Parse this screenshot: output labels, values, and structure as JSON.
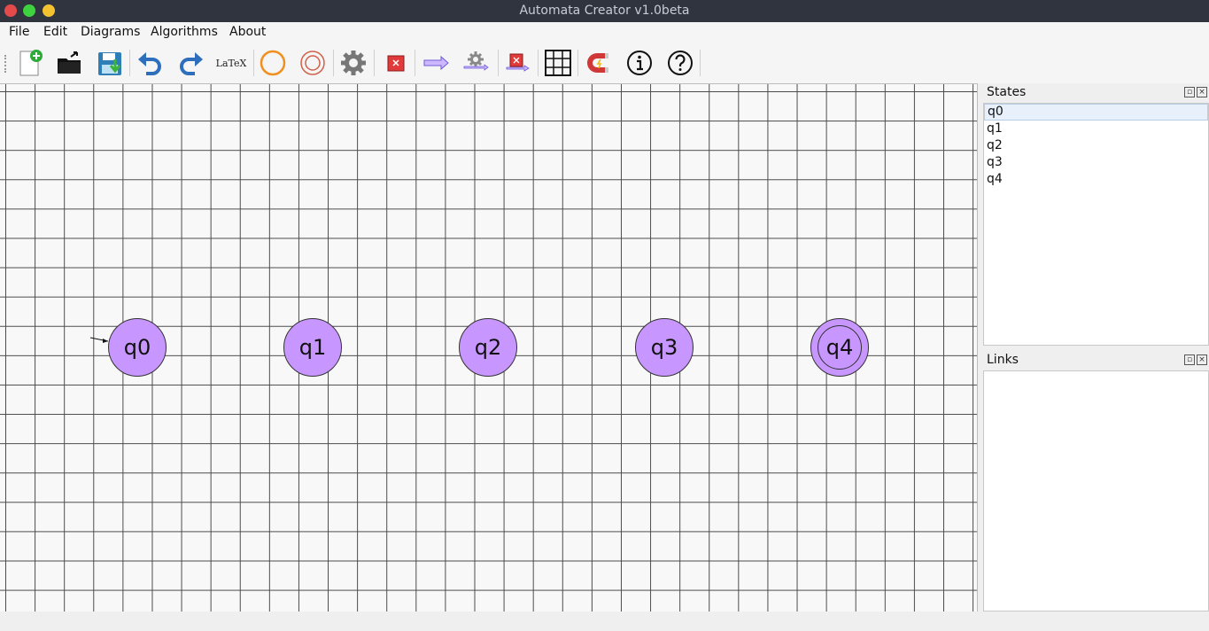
{
  "window": {
    "title": "Automata Creator v1.0beta"
  },
  "menu": {
    "items": [
      "File",
      "Edit",
      "Diagrams",
      "Algorithms",
      "About"
    ]
  },
  "toolbar": {
    "latex_label": "LaTeX",
    "buttons": [
      "new-document-icon",
      "open-folder-icon",
      "save-icon",
      "undo-icon",
      "redo-icon",
      "latex-icon",
      "add-state-icon",
      "add-final-state-icon",
      "state-settings-icon",
      "delete-state-icon",
      "add-link-icon",
      "link-settings-icon",
      "delete-link-icon",
      "grid-icon",
      "magnet-icon",
      "info-icon",
      "help-icon"
    ]
  },
  "diagram": {
    "initial_state": "q0",
    "states": [
      {
        "name": "q0",
        "final": false
      },
      {
        "name": "q1",
        "final": false
      },
      {
        "name": "q2",
        "final": false
      },
      {
        "name": "q3",
        "final": false
      },
      {
        "name": "q4",
        "final": true
      }
    ]
  },
  "states_panel": {
    "title": "States",
    "items": [
      "q0",
      "q1",
      "q2",
      "q3",
      "q4"
    ],
    "selected": "q0"
  },
  "links_panel": {
    "title": "Links",
    "items": []
  },
  "colors": {
    "state_fill": "#c896ff",
    "titlebar": "#2f343f",
    "selection": "#e7f0fb"
  }
}
